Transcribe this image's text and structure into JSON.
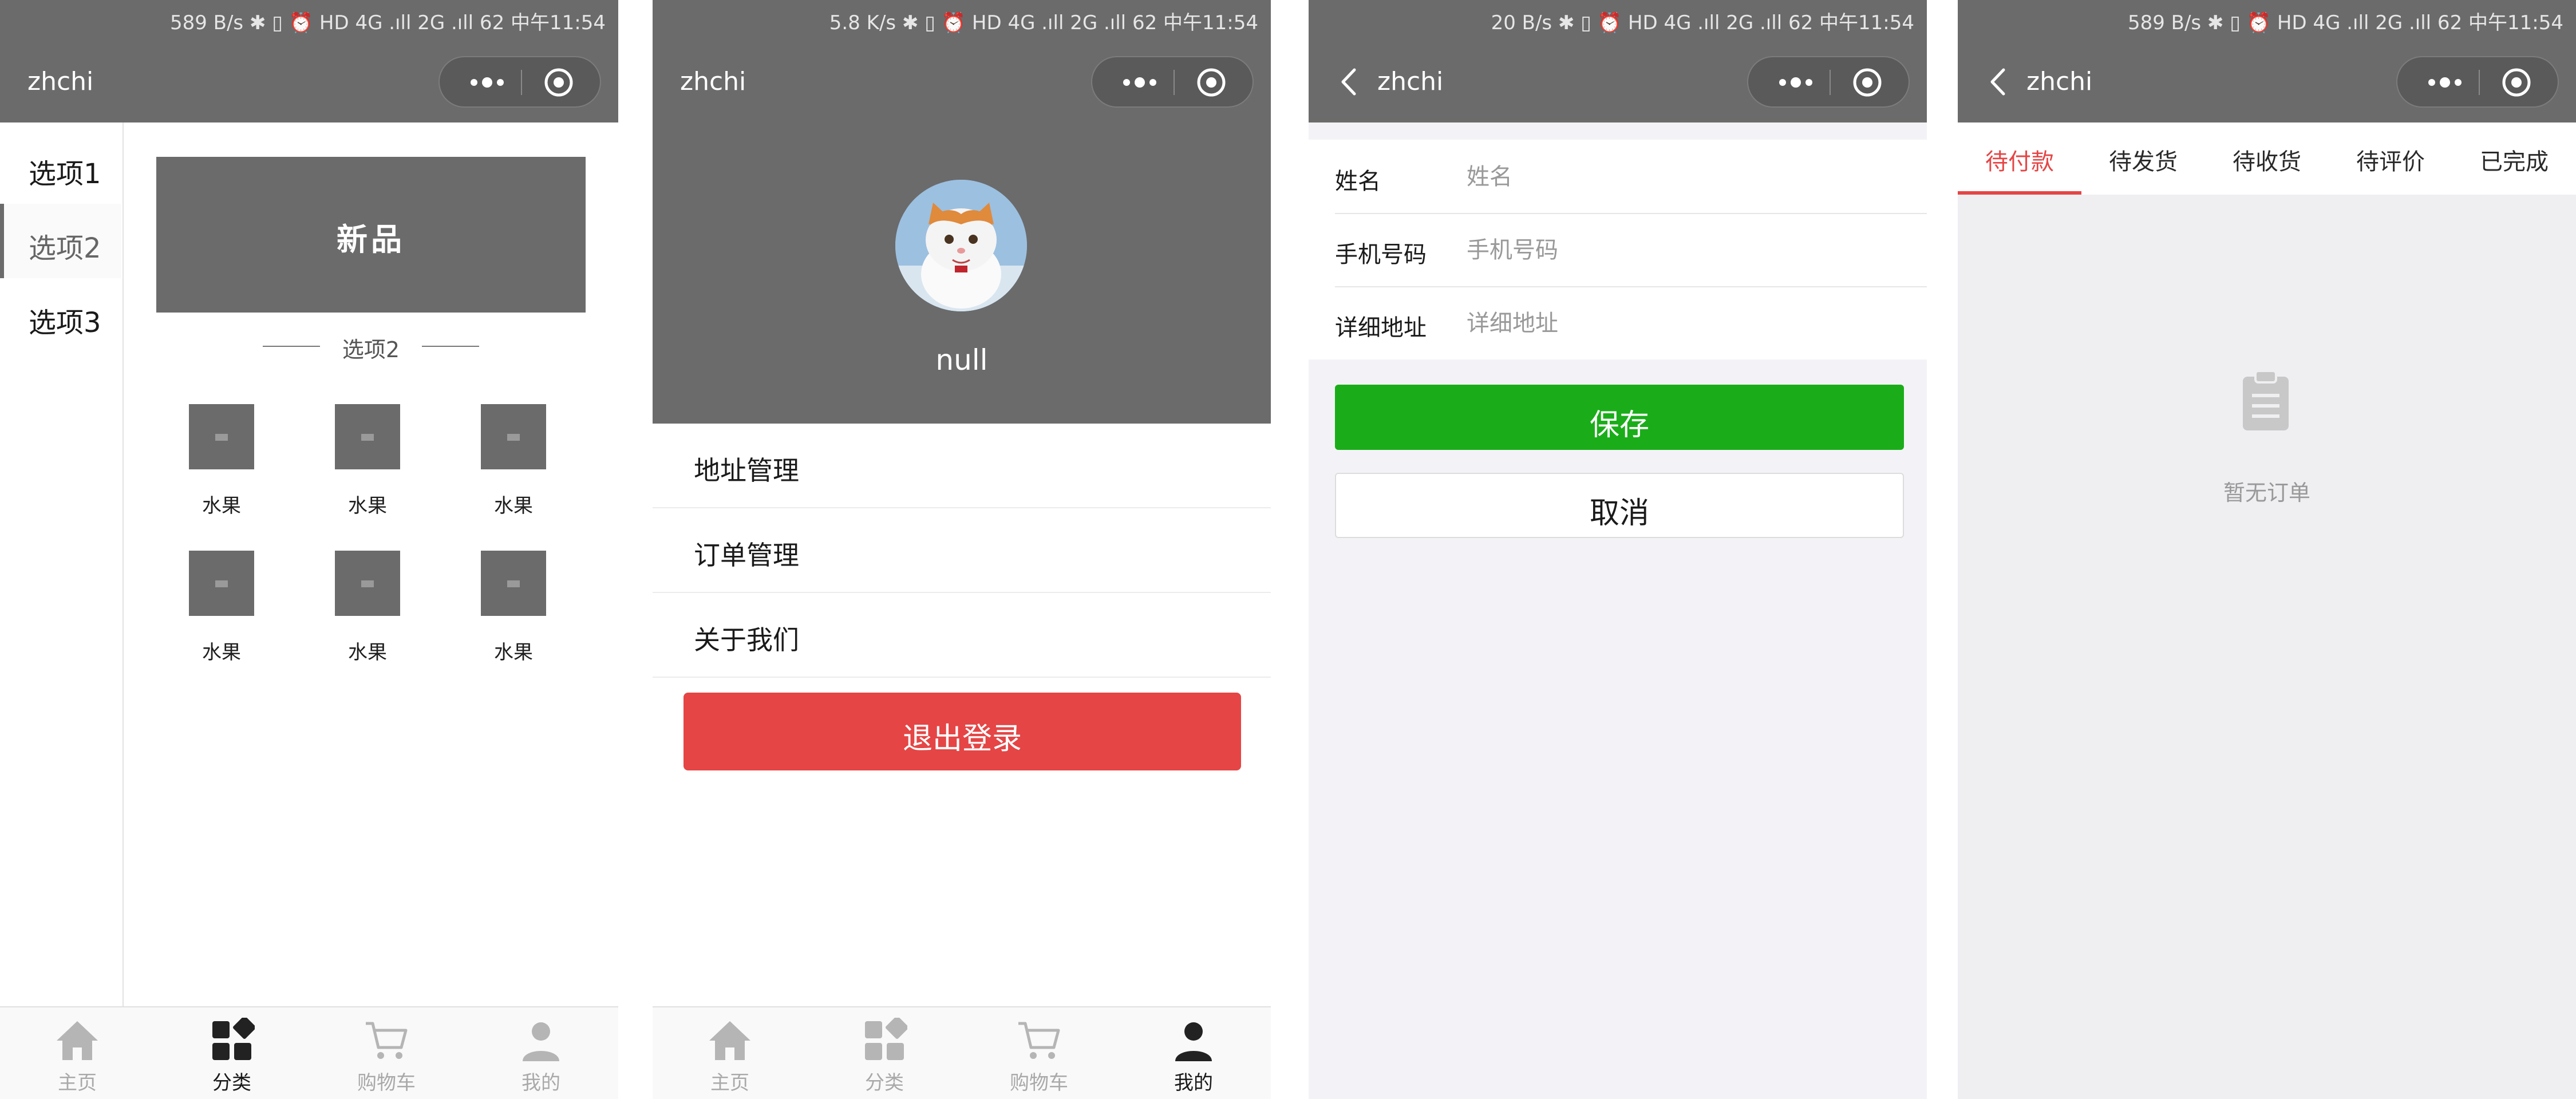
{
  "screens": {
    "category": {
      "status": "589 B/s ✱ ▯ ⏰ HD 4G .ıll 2G .ıll 62 中午11:54",
      "title": "zhchi",
      "sidebar": [
        {
          "label": "选项1"
        },
        {
          "label": "选项2"
        },
        {
          "label": "选项3"
        }
      ],
      "active_sidebar": "选项2",
      "banner_text": "新品",
      "section_title": "选项2",
      "products": [
        {
          "label": "水果"
        },
        {
          "label": "水果"
        },
        {
          "label": "水果"
        },
        {
          "label": "水果"
        },
        {
          "label": "水果"
        },
        {
          "label": "水果"
        }
      ],
      "tabbar": [
        {
          "label": "主页",
          "icon": "home-icon"
        },
        {
          "label": "分类",
          "icon": "category-icon"
        },
        {
          "label": "购物车",
          "icon": "cart-icon"
        },
        {
          "label": "我的",
          "icon": "person-icon"
        }
      ],
      "active_tab": "分类"
    },
    "profile": {
      "status": "5.8 K/s ✱ ▯ ⏰ HD 4G .ıll 2G .ıll 62 中午11:54",
      "title": "zhchi",
      "username": "null",
      "menu": [
        {
          "label": "地址管理"
        },
        {
          "label": "订单管理"
        },
        {
          "label": "关于我们"
        }
      ],
      "logout_label": "退出登录",
      "tabbar": [
        {
          "label": "主页"
        },
        {
          "label": "分类"
        },
        {
          "label": "购物车"
        },
        {
          "label": "我的"
        }
      ],
      "active_tab": "我的"
    },
    "address": {
      "status": "20 B/s ✱ ▯ ⏰ HD 4G .ıll 2G .ıll 62 中午11:54",
      "title": "zhchi",
      "fields": [
        {
          "label": "姓名",
          "placeholder": "姓名",
          "value": ""
        },
        {
          "label": "手机号码",
          "placeholder": "手机号码",
          "value": ""
        },
        {
          "label": "详细地址",
          "placeholder": "详细地址",
          "value": ""
        }
      ],
      "save_label": "保存",
      "cancel_label": "取消"
    },
    "orders": {
      "status": "589 B/s ✱ ▯ ⏰ HD 4G .ıll 2G .ıll 62 中午11:54",
      "title": "zhchi",
      "tabs": [
        {
          "label": "待付款"
        },
        {
          "label": "待发货"
        },
        {
          "label": "待收货"
        },
        {
          "label": "待评价"
        },
        {
          "label": "已完成"
        }
      ],
      "active_tab": "待付款",
      "empty_text": "暂无订单"
    }
  },
  "colors": {
    "header": "#6b6b6b",
    "primary_green": "#1aad19",
    "danger_red": "#e54545",
    "tab_inactive": "#a9a9a9"
  }
}
